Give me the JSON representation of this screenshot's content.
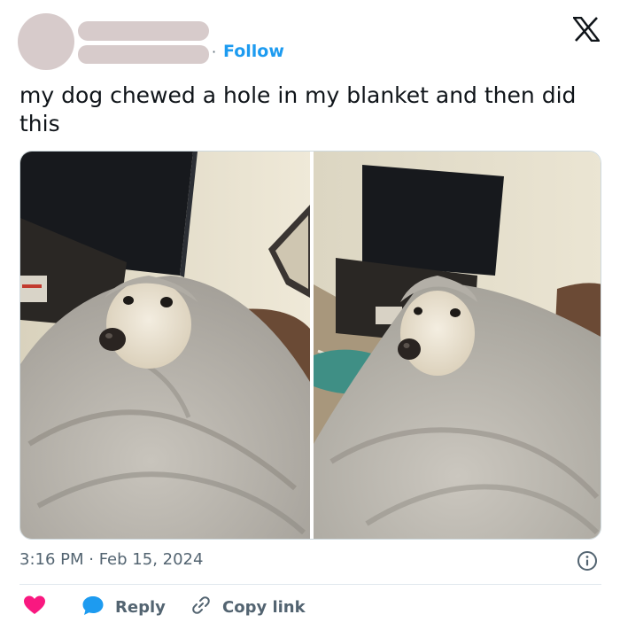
{
  "tweet": {
    "follow_label": "Follow",
    "separator": "·",
    "text": "my dog chewed a hole in my blanket and then did this",
    "timestamp": "3:16 PM · Feb 15, 2024"
  },
  "actions": {
    "reply_label": "Reply",
    "copy_label": "Copy link"
  },
  "icons": {
    "brand": "x-logo-icon",
    "info": "info-icon",
    "like": "heart-icon",
    "reply": "reply-bubble-icon",
    "copy": "link-icon"
  },
  "colors": {
    "accent": "#1d9bf0",
    "like": "#f91880",
    "muted": "#536471",
    "placeholder": "#d7cbcb"
  }
}
